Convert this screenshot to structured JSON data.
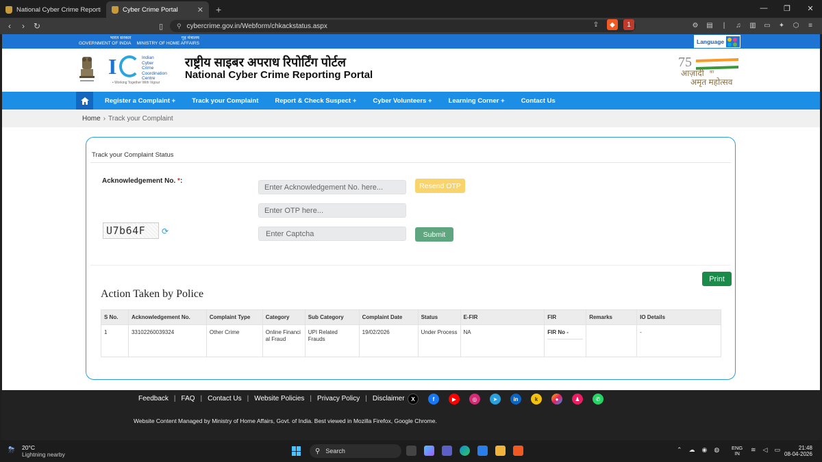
{
  "browser": {
    "tabs": [
      {
        "label": "National Cyber Crime Reporting Port",
        "active": false
      },
      {
        "label": "Cyber Crime Portal",
        "active": true
      }
    ],
    "url": "cybercrime.gov.in/Webform/chkackstatus.aspx",
    "shield_count": "1"
  },
  "site": {
    "gov_hi": "भारत सरकार",
    "gov_en": "GOVERNMENT OF INDIA",
    "mha_hi": "गृह मंत्रालय",
    "mha_en": "MINISTRY OF HOME AFFAIRS",
    "language_label": "Language",
    "i4c_words": [
      "Indian",
      "Cyber",
      "Crime",
      "Coordination",
      "Centre"
    ],
    "i4c_tagline": "• Working Together With Vigour",
    "title_hi": "राष्ट्रीय साइबर अपराध रिपोर्टिंग पोर्टल",
    "title_en": "National Cyber Crime Reporting Portal",
    "azadi_line1": "आज़ादी",
    "azadi_ka": "का",
    "azadi_line2": "अमृत महोत्सव",
    "azadi_num": "75"
  },
  "nav": {
    "items": [
      "Register a Complaint +",
      "Track your Complaint",
      "Report & Check Suspect +",
      "Cyber Volunteers +",
      "Learning Corner +",
      "Contact Us"
    ]
  },
  "breadcrumb": {
    "home": "Home",
    "sep": "›",
    "current": "Track your Complaint"
  },
  "form": {
    "section_title": "Track your Complaint Status",
    "ack_label": "Acknowledgement No.",
    "required_mark": "*",
    "colon": ":",
    "ack_placeholder": "Enter Acknowledgement No. here...",
    "resend_otp": "Resend OTP",
    "otp_placeholder": "Enter OTP here...",
    "captcha_text": "U7b64F",
    "captcha_placeholder": "Enter Captcha",
    "submit": "Submit",
    "print": "Print"
  },
  "actions": {
    "heading": "Action Taken by Police",
    "columns": [
      "S No.",
      "Acknowledgement No.",
      "Complaint Type",
      "Category",
      "Sub Category",
      "Complaint Date",
      "Status",
      "E-FIR",
      "FIR",
      "Remarks",
      "IO Details"
    ],
    "rows": [
      [
        "1",
        "33102260039324",
        "Other Crime",
        "Online Financi al Fraud",
        "UPI Related Frauds",
        "19/02/2026",
        "Under Process",
        "NA",
        "FIR No -",
        "",
        "-"
      ]
    ]
  },
  "footer": {
    "links": [
      "Feedback",
      "FAQ",
      "Contact Us",
      "Website Policies",
      "Privacy Policy",
      "Disclaimer"
    ],
    "social": [
      {
        "name": "x-icon",
        "color": "#000000"
      },
      {
        "name": "facebook-icon",
        "color": "#1877f2"
      },
      {
        "name": "youtube-icon",
        "color": "#ff0000"
      },
      {
        "name": "instagram-icon",
        "color": "#d62976"
      },
      {
        "name": "telegram-icon",
        "color": "#2aa1da"
      },
      {
        "name": "linkedin-icon",
        "color": "#0a66c2"
      },
      {
        "name": "koo-icon",
        "color": "#f4c20d"
      },
      {
        "name": "sharechat-icon",
        "color": "#f7b500"
      },
      {
        "name": "moj-icon",
        "color": "#e91e63"
      },
      {
        "name": "whatsapp-icon",
        "color": "#25d366"
      }
    ],
    "copyright": "Website Content Managed by Ministry of Home Affairs, Govt. of India. Best viewed in Mozilla Firefox, Google Chrome."
  },
  "taskbar": {
    "temp": "20°C",
    "weather": "Lightning nearby",
    "search": "Search",
    "lang1": "ENG",
    "lang2": "IN",
    "time": "21:48",
    "date": "08-04-2026"
  }
}
